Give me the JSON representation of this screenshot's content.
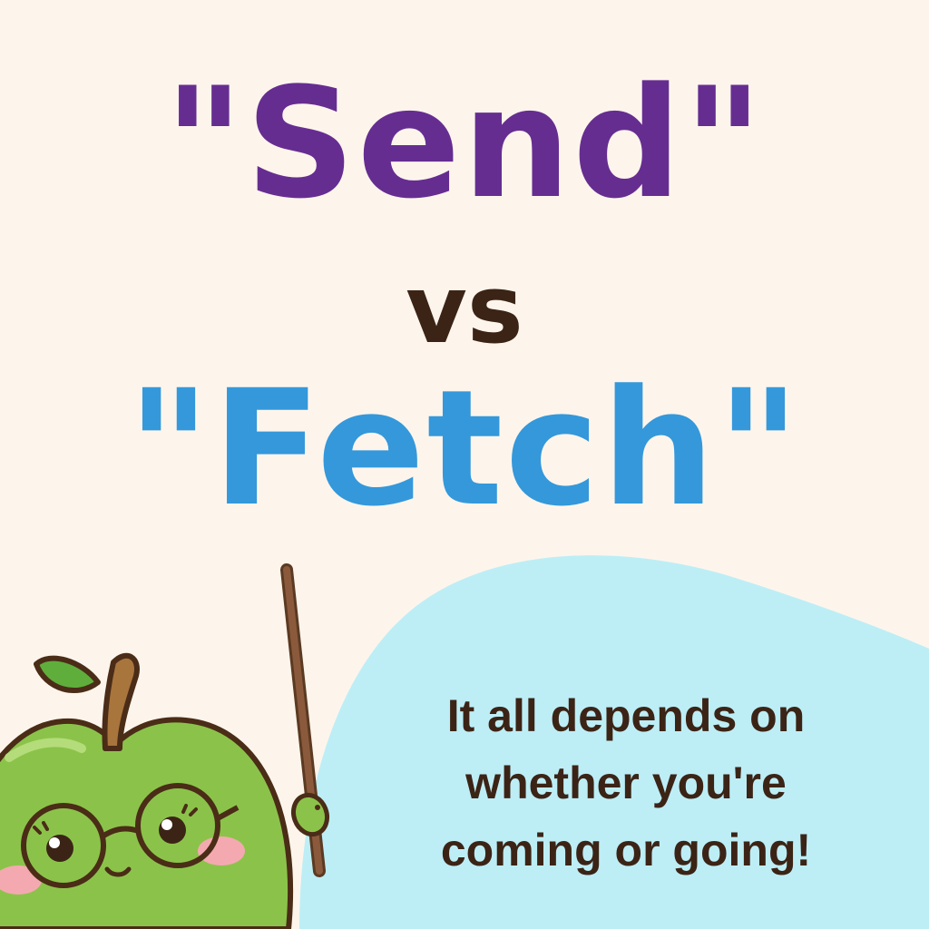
{
  "headline": {
    "word1": "\"Send\"",
    "connector": "vs",
    "word2": "\"Fetch\""
  },
  "caption": {
    "line1": "It all depends on",
    "line2": "whether you're",
    "line3": "coming or going!"
  },
  "colors": {
    "background": "#fdf5ec",
    "wave": "#bdeef6",
    "word1": "#662d91",
    "connector": "#3b2416",
    "word2": "#3498db",
    "caption": "#3b2416",
    "apple": "#8bc34a",
    "pointer": "#8b5a3c"
  },
  "illustration": {
    "character": "apple-teacher-with-glasses-and-pointer"
  }
}
